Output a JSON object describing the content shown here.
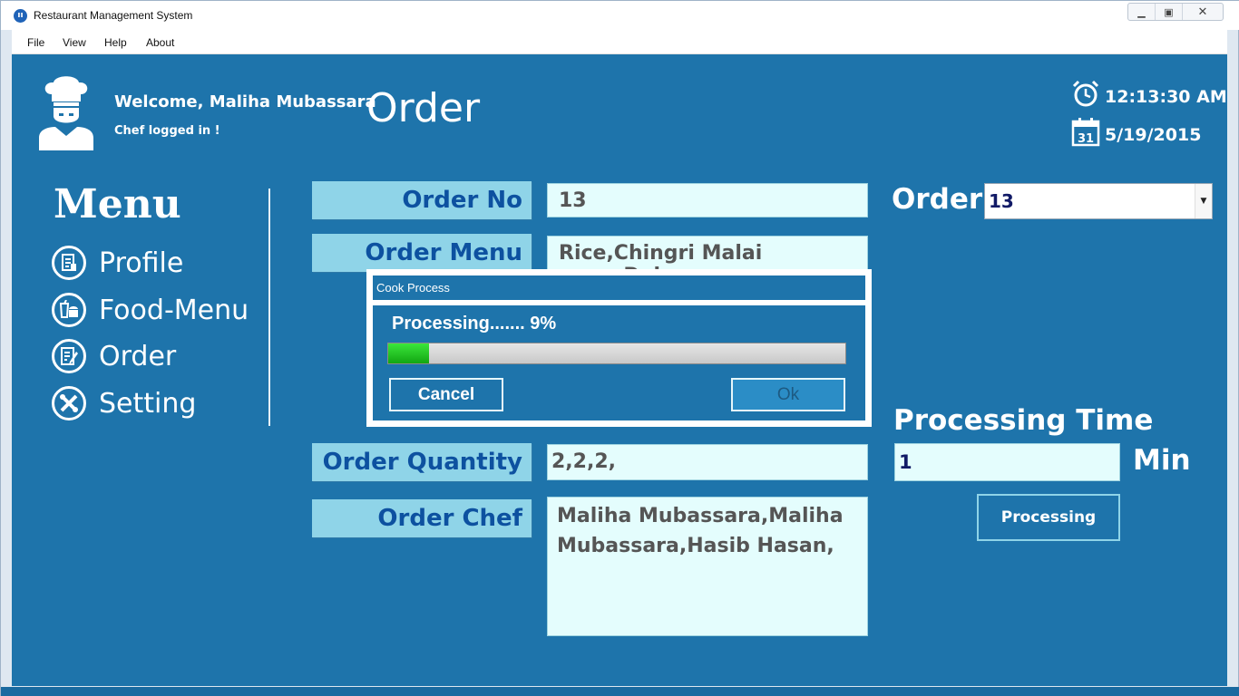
{
  "window": {
    "title": "Restaurant Management System"
  },
  "menubar": {
    "items": [
      "File",
      "View",
      "Help",
      "About"
    ]
  },
  "header": {
    "welcome": "Welcome, Maliha Mubassara",
    "status": "Chef logged in !",
    "page_title": "Order",
    "time": "12:13:30 AM",
    "date": "5/19/2015",
    "calendar_day": "31"
  },
  "sidebar": {
    "heading": "Menu",
    "items": [
      {
        "label": "Profile",
        "icon": "profile-icon"
      },
      {
        "label": "Food-Menu",
        "icon": "food-menu-icon"
      },
      {
        "label": "Order",
        "icon": "order-icon"
      },
      {
        "label": "Setting",
        "icon": "setting-icon"
      }
    ]
  },
  "form": {
    "order_no_label": "Order No",
    "order_no_value": "13",
    "order_menu_label": "Order Menu",
    "order_menu_value": "Rice,Chingri Malai curry,Dal",
    "order_quantity_label": "Order Quantity",
    "order_quantity_value": "2,2,2,",
    "order_chef_label": "Order Chef",
    "order_chef_value": "Maliha Mubassara,Maliha Mubassara,Hasib Hasan,"
  },
  "right_panel": {
    "order_label": "Order",
    "order_selected": "13",
    "processing_time_label": "Processing Time",
    "processing_time_value": "1",
    "unit_label": "Min",
    "processing_button": "Processing"
  },
  "dialog": {
    "title": "Cook Process",
    "status": "Processing....... 9%",
    "progress": 0.09,
    "cancel_label": "Cancel",
    "ok_label": "Ok"
  },
  "colors": {
    "background": "#1e74ab",
    "label_bg": "#8fd4e8",
    "label_text": "#0d51a0",
    "field_bg": "#e4fdfd",
    "progress_fill": "#22c022"
  }
}
